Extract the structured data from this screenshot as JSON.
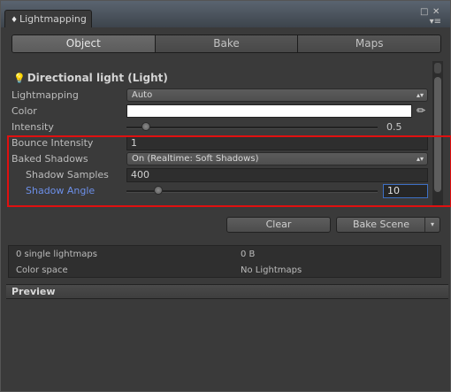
{
  "window": {
    "tab_title": "Lightmapping",
    "tab_icon": "♦",
    "menu_icon": "▾≡"
  },
  "tabs": [
    {
      "label": "Object",
      "active": true
    },
    {
      "label": "Bake",
      "active": false
    },
    {
      "label": "Maps",
      "active": false
    }
  ],
  "section": {
    "title": "Directional light (Light)",
    "icon": "light-bulb-icon"
  },
  "fields": {
    "lightmapping": {
      "label": "Lightmapping",
      "value": "Auto"
    },
    "color": {
      "label": "Color",
      "value": "#ffffff"
    },
    "intensity": {
      "label": "Intensity",
      "value": "0.5",
      "fraction": 0.06
    },
    "bounce_intensity": {
      "label": "Bounce Intensity",
      "value": "1"
    },
    "baked_shadows": {
      "label": "Baked Shadows",
      "value": "On (Realtime: Soft Shadows)"
    },
    "shadow_samples": {
      "label": "Shadow Samples",
      "value": "400"
    },
    "shadow_angle": {
      "label": "Shadow Angle",
      "value": "10",
      "fraction": 0.11
    }
  },
  "buttons": {
    "clear": "Clear",
    "bake_scene": "Bake Scene",
    "split_arrow": "▾"
  },
  "stats": {
    "lightmaps": "0 single lightmaps",
    "size": "0 B",
    "color_space_label": "Color space",
    "color_space_value": "No Lightmaps"
  },
  "preview": {
    "title": "Preview"
  },
  "colors": {
    "highlight": "#e01010",
    "accent": "#3d6fc4",
    "active_label": "#6c8fe8"
  }
}
